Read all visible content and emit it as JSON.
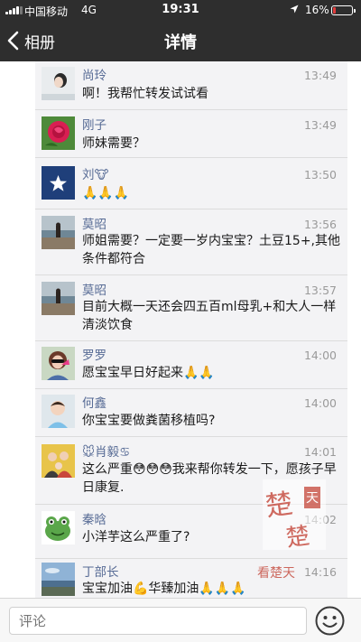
{
  "status_bar": {
    "carrier": "中国移动",
    "network": "4G",
    "time": "19:31",
    "battery": "16%",
    "battery_level": 0.16,
    "battery_color": "#e23c3c"
  },
  "nav": {
    "back_label": "相册",
    "title": "详情"
  },
  "colors": {
    "nav_background": "#2e2e2e",
    "nickname": "#576b95",
    "comment_panel": "#f3f3f5"
  },
  "comments": [
    {
      "name": "尚玲",
      "time": "13:49",
      "text": "啊！我帮忙转发试试看",
      "avatar": "woman-portrait-avatar"
    },
    {
      "name": "刚子",
      "time": "13:49",
      "text": "师妹需要？",
      "avatar": "red-rose-avatar"
    },
    {
      "name": "刘🐮",
      "time": "13:50",
      "text": "🙏🙏🙏",
      "avatar": "white-star-avatar"
    },
    {
      "name": "莫昭",
      "time": "13:56",
      "text": "师姐需要？一定要一岁内宝宝？土豆15+,其他条件都符合",
      "avatar": "beach-person-avatar"
    },
    {
      "name": "莫昭",
      "time": "13:57",
      "text": "目前大概一天还会四五百ml母乳+和大人一样清淡饮食",
      "avatar": "beach-person-avatar"
    },
    {
      "name": "罗罗",
      "time": "14:00",
      "text": "愿宝宝早日好起来🙏🙏",
      "avatar": "sunglasses-woman-avatar"
    },
    {
      "name": "何鑫",
      "time": "14:00",
      "text": "你宝宝要做粪菌移植吗?",
      "avatar": "child-avatar"
    },
    {
      "name": "🐭肖毅♋",
      "time": "14:01",
      "text": "这么严重😳😳😳我来帮你转发一下，愿孩子早日康复.",
      "avatar": "family-photo-avatar"
    },
    {
      "name": "秦晗",
      "time": "14:02",
      "text": "小洋芋这么严重了?",
      "avatar": "green-frog-avatar"
    },
    {
      "name": "丁部长",
      "time": "14:16",
      "text": "宝宝加油💪华臻加油🙏🙏🙏",
      "avatar": "sky-landscape-avatar"
    }
  ],
  "input": {
    "placeholder": "评论"
  },
  "icons": {
    "back": "chevron-left-icon",
    "emoji": "smiley-face-icon",
    "location": "location-arrow-icon"
  },
  "watermark": {
    "big_char_1": "楚",
    "big_char_2": "楚",
    "seal_char": "天",
    "label": "看楚天"
  }
}
